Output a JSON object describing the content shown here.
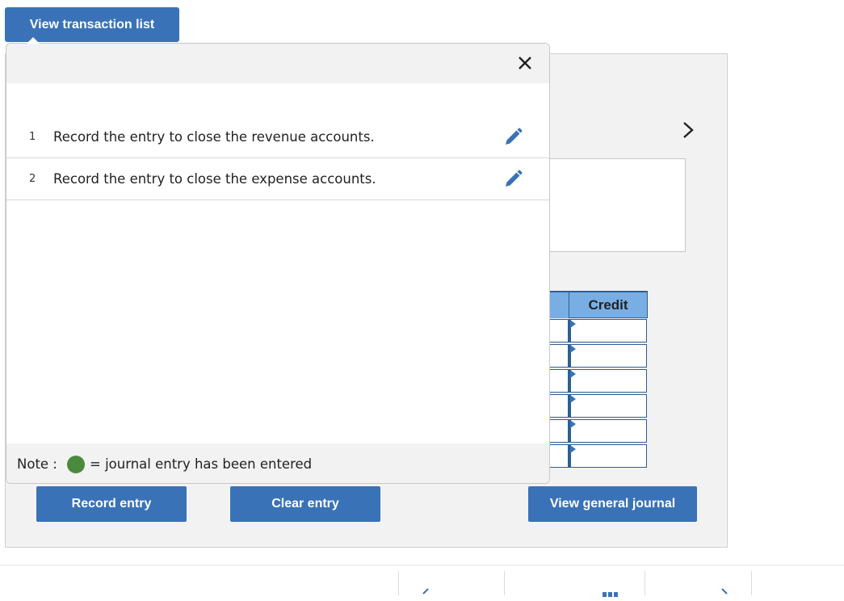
{
  "top_tab": {
    "label": "View transaction list"
  },
  "popover": {
    "close_icon": "close-icon",
    "transactions": [
      {
        "number": "1",
        "text": "Record the entry to close the revenue accounts.",
        "icon": "pencil-icon"
      },
      {
        "number": "2",
        "text": "Record the entry to close the expense accounts.",
        "icon": "pencil-icon"
      }
    ],
    "note": {
      "label": "Note :",
      "legend_color": "#4b8a3e",
      "text": "= journal entry has been entered"
    }
  },
  "journal": {
    "next_icon": "chevron-right-icon",
    "credit_header": "Credit",
    "row_count": 6
  },
  "buttons": {
    "record_entry": "Record entry",
    "clear_entry": "Clear entry",
    "view_general_journal": "View general journal"
  },
  "colors": {
    "accent": "#3a72b8",
    "grid_header": "#78aee4",
    "panel_bg": "#f2f2f2",
    "entered_green": "#4b8a3e"
  }
}
